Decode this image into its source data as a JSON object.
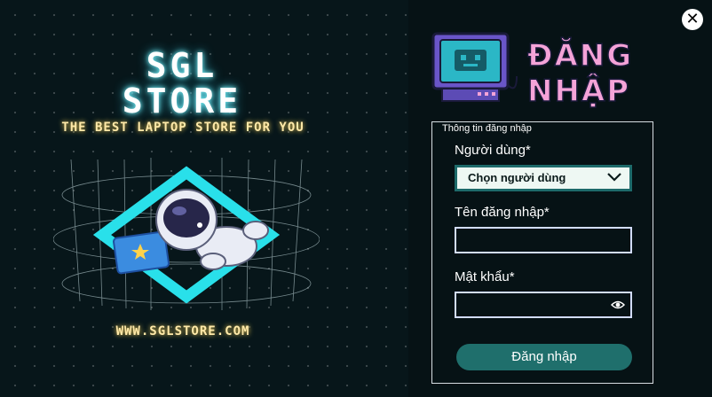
{
  "brand": {
    "line1": "SGL",
    "line2": "STORE",
    "tagline": "THE BEST LAPTOP STORE FOR YOU",
    "website": "WWW.SGLSTORE.COM"
  },
  "header": {
    "logo_line1": "ĐĂNG",
    "logo_line2": "NHẬP",
    "close_icon": "close-icon"
  },
  "form": {
    "legend": "Thông tin đăng nhập",
    "user_type_label": "Người dùng*",
    "user_type_selected": "Chọn người dùng",
    "username_label": "Tên đăng nhập*",
    "username_value": "",
    "password_label": "Mật khẩu*",
    "password_value": "",
    "submit_label": "Đăng nhập"
  },
  "colors": {
    "background": "#061215",
    "accent": "#1f6f6c",
    "logo_pink": "#f5a3d8",
    "logo_cyan": "#27b7c8",
    "tagline_yellow": "#ffe9a8"
  }
}
